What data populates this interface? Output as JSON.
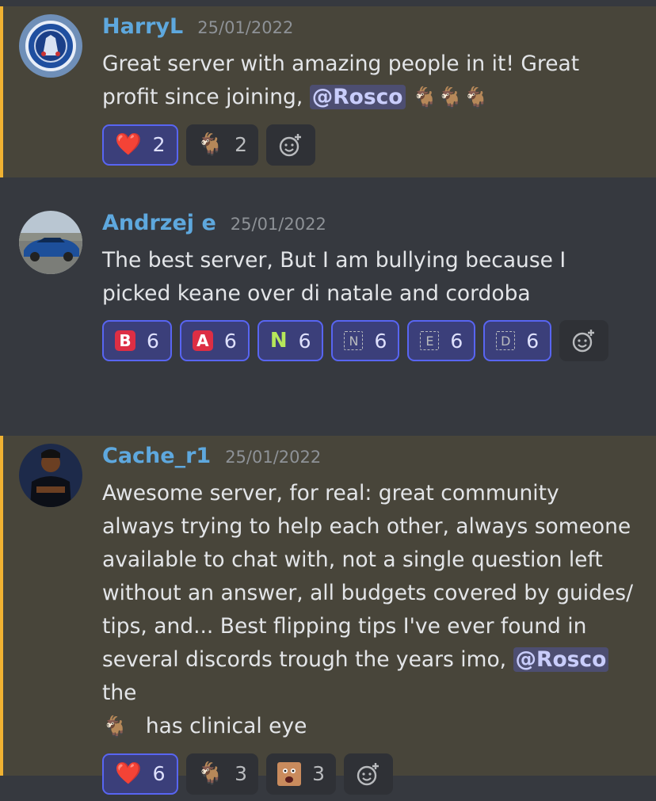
{
  "messages": [
    {
      "username": "HarryL",
      "timestamp": "25/01/2022",
      "text_before": "Great server with amazing people in it! Great profit since joining,",
      "mention": "@Rosco",
      "inline_emoji": [
        "🐐",
        "🐐",
        "🐐"
      ],
      "reactions": [
        {
          "emoji": "❤️",
          "count": "2",
          "me": true
        },
        {
          "emoji": "🐐",
          "count": "2",
          "me": false
        }
      ]
    },
    {
      "username": "Andrzej e",
      "timestamp": "25/01/2022",
      "text": "The best server, But I am bullying because I picked keane over di natale and cordoba",
      "reactions": [
        {
          "letter": "B",
          "count": "6"
        },
        {
          "letter": "A",
          "count": "6"
        },
        {
          "letter": "N",
          "count": "6"
        },
        {
          "letter": "N",
          "count": "6"
        },
        {
          "letter": "E",
          "count": "6"
        },
        {
          "letter": "D",
          "count": "6"
        }
      ]
    },
    {
      "username": "Cache_r1",
      "timestamp": "25/01/2022",
      "text_before": "Awesome server, for real: great community always trying to help each other, always someone available to chat with, not a single question left without an answer, all budgets covered by guides/ tips, and... Best flipping tips I've ever found in several discords trough the years imo,",
      "mention": "@Rosco",
      "text_after": "the",
      "inline_emoji": "🐐",
      "text_end": "has clinical eye",
      "reactions": [
        {
          "emoji": "❤️",
          "count": "6",
          "me": true
        },
        {
          "emoji": "🐐",
          "count": "3",
          "me": false
        },
        {
          "emoji": "custom-face-emoji",
          "count": "3",
          "me": false
        }
      ]
    }
  ],
  "icons": {
    "add_reaction": "add-reaction-icon",
    "heart": "heart-emoji",
    "goat": "goat-emoji"
  },
  "colors": {
    "username": "#5ea8de",
    "mention_bg": "#5865f24d",
    "highlight_bar": "#f0b232",
    "reaction_me_border": "#5865f2"
  }
}
